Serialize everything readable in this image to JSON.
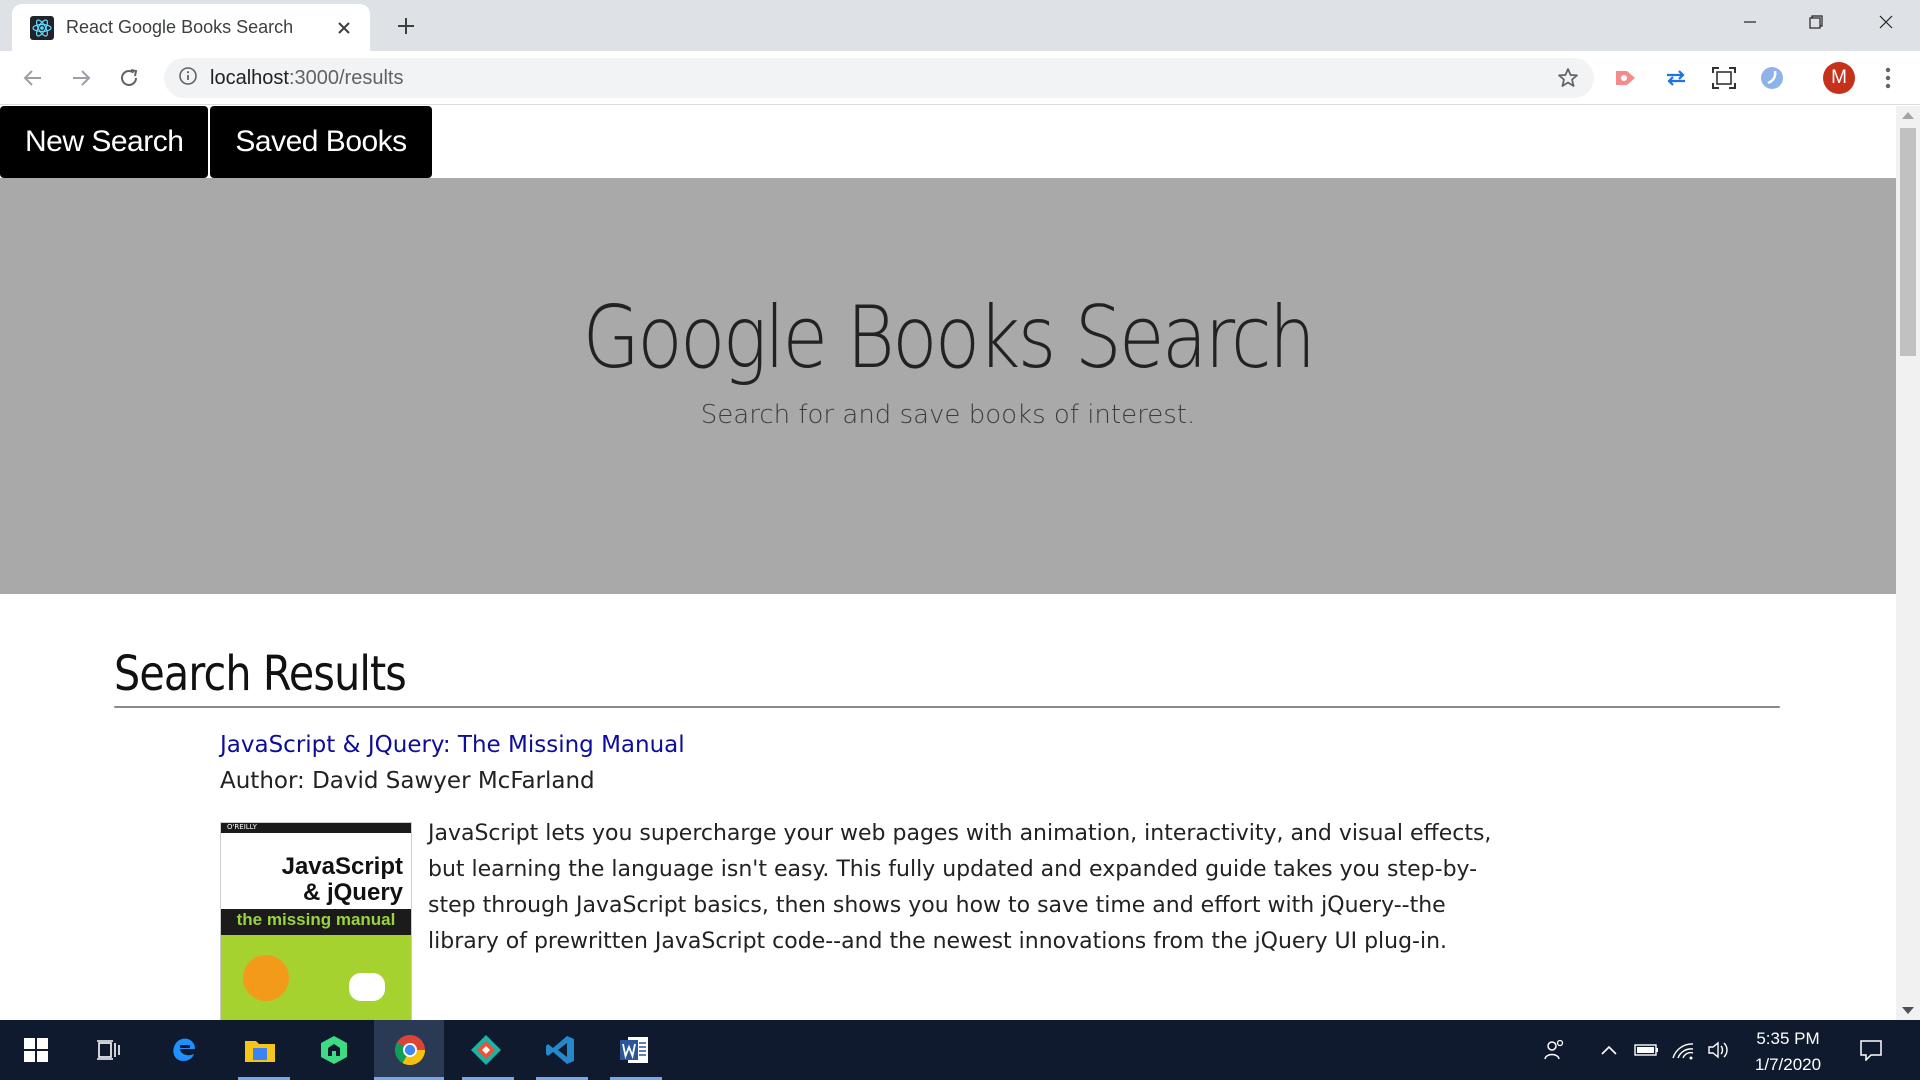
{
  "browser": {
    "tab_title": "React Google Books Search",
    "url_host": "localhost",
    "url_rest": ":3000/results",
    "avatar_initial": "M"
  },
  "nav": {
    "new_search": "New Search",
    "saved_books": "Saved Books"
  },
  "hero": {
    "title": "Google Books Search",
    "subtitle": "Search for and save books of interest."
  },
  "results": {
    "heading": "Search Results",
    "items": [
      {
        "title": "JavaScript & JQuery: The Missing Manual",
        "author": "Author: David Sawyer McFarland",
        "description": "JavaScript lets you supercharge your web pages with animation, interactivity, and visual effects, but learning the language isn't easy. This fully updated and expanded guide takes you step-by-step through JavaScript basics, then shows you how to save time and effort with jQuery--the library of prewritten JavaScript code--and the newest innovations from the jQuery UI plug-in.",
        "cover": {
          "publisher": "O'REILLY",
          "title_line1": "JavaScript",
          "title_line2": "& jQuery",
          "band": "the missing manual"
        }
      }
    ]
  },
  "taskbar": {
    "time": "5:35 PM",
    "date": "1/7/2020"
  },
  "colors": {
    "hero_bg": "#a9a9a9",
    "nav_bg": "#000000",
    "link": "#0d0d9a",
    "taskbar": "#0f1a2e"
  }
}
